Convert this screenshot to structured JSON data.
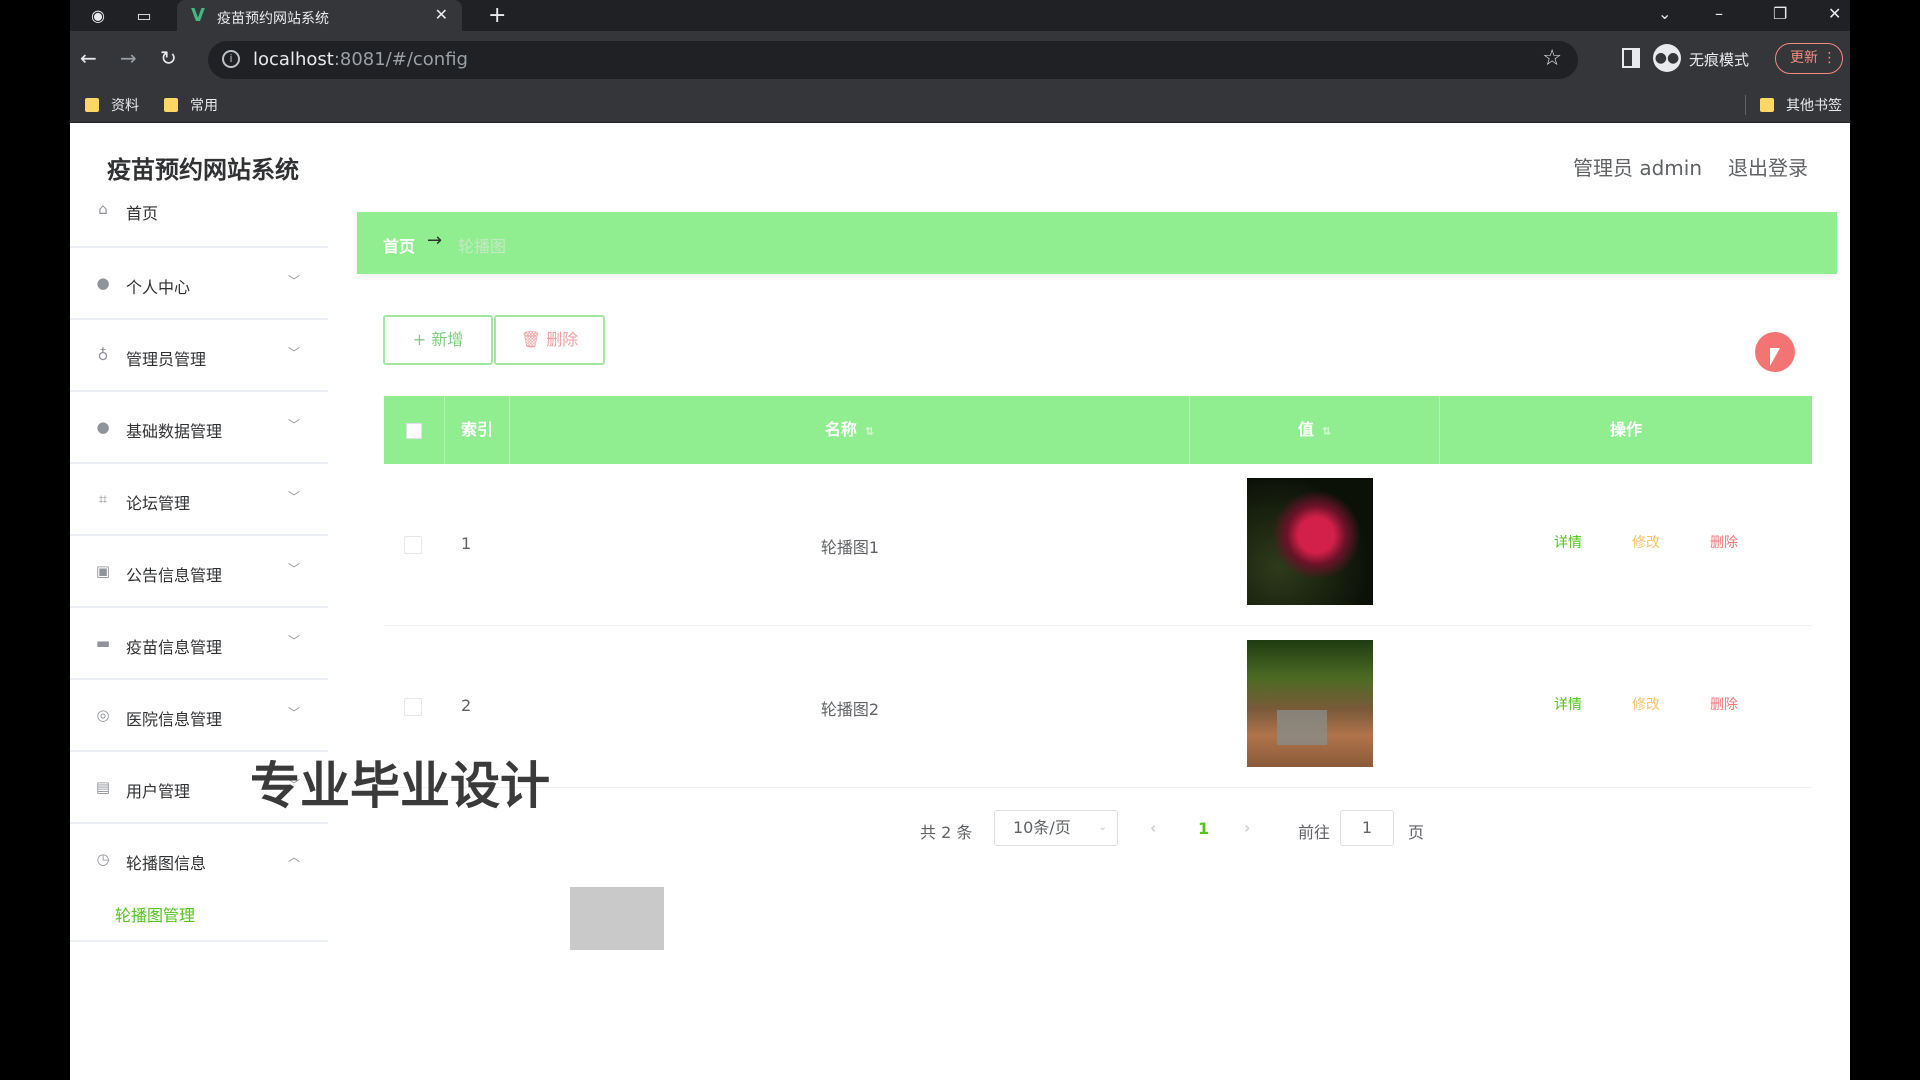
{
  "browser": {
    "tab_title": "疫苗预约网站系统",
    "url_host": "localhost",
    "url_rest": ":8081/#/config",
    "incognito_label": "无痕模式",
    "update_label": "更新",
    "bookmarks": [
      "资料",
      "常用"
    ],
    "other_bookmarks": "其他书签"
  },
  "header": {
    "site_title": "疫苗预约网站系统",
    "user_label": "管理员 admin",
    "logout_label": "退出登录"
  },
  "sidebar": {
    "items": [
      {
        "label": "首页",
        "icon": "home-icon"
      },
      {
        "label": "个人中心",
        "icon": "user-icon"
      },
      {
        "label": "管理员管理",
        "icon": "microphone-icon"
      },
      {
        "label": "基础数据管理",
        "icon": "user-icon"
      },
      {
        "label": "论坛管理",
        "icon": "crop-icon"
      },
      {
        "label": "公告信息管理",
        "icon": "chart-icon"
      },
      {
        "label": "疫苗信息管理",
        "icon": "message-icon"
      },
      {
        "label": "医院信息管理",
        "icon": "globe-icon"
      },
      {
        "label": "用户管理",
        "icon": "clipboard-icon"
      },
      {
        "label": "轮播图信息",
        "icon": "compass-icon"
      }
    ],
    "submenu_label": "轮播图管理"
  },
  "breadcrumb": {
    "home": "首页",
    "current": "轮播图"
  },
  "toolbar": {
    "add_label": "+ 新增",
    "delete_label": "删除"
  },
  "table": {
    "columns": [
      "索引",
      "名称",
      "值",
      "操作"
    ],
    "rows": [
      {
        "index": "1",
        "name": "轮播图1"
      },
      {
        "index": "2",
        "name": "轮播图2"
      }
    ],
    "actions": {
      "detail": "详情",
      "edit": "修改",
      "delete": "删除"
    }
  },
  "pagination": {
    "total": "共 2 条",
    "page_size": "10条/页",
    "current_page": "1",
    "goto_label": "前往",
    "goto_value": "1",
    "page_unit": "页"
  },
  "overlay": {
    "watermark": "专业毕业设计"
  }
}
